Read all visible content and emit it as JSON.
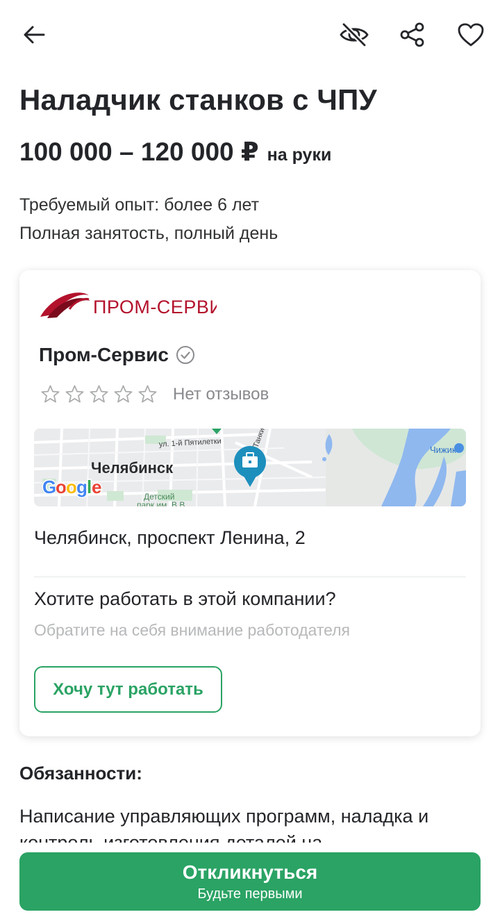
{
  "header": {
    "back_icon": "arrow-left-icon",
    "hide_icon": "eye-off-icon",
    "share_icon": "share-icon",
    "favorite_icon": "heart-icon"
  },
  "vacancy": {
    "title": "Наладчик станков с ЧПУ",
    "salary": "100 000 – 120 000 ₽",
    "salary_note": "на руки",
    "experience": "Требуемый опыт: более 6 лет",
    "employment": "Полная занятость, полный день"
  },
  "company": {
    "logo_text": "ПРОМ-СЕРВИС",
    "name": "Пром-Сервис",
    "rating_stars": 0,
    "reviews": "Нет отзывов",
    "map": {
      "city": "Челябинск",
      "street_1": "ул. 1-й Пятилетки",
      "street_2": "Танкистов",
      "park": "Детский\nпарк им. В.В.",
      "store": "Чижик",
      "google": "Google"
    },
    "address": "Челябинск, проспект Ленина, 2",
    "question": "Хотите работать в этой компании?",
    "question_sub": "Обратите на себя внимание работодателя",
    "want_button": "Хочу тут работать"
  },
  "duties": {
    "title": "Обязанности:",
    "text": "Написание управляющих программ, наладка и контроль изготовления деталей на"
  },
  "respond": {
    "label": "Откликнуться",
    "sub": "Будьте первыми"
  },
  "colors": {
    "accent": "#2aa364",
    "text": "#232529",
    "muted": "#888a8d",
    "logo_red": "#b3122c"
  }
}
